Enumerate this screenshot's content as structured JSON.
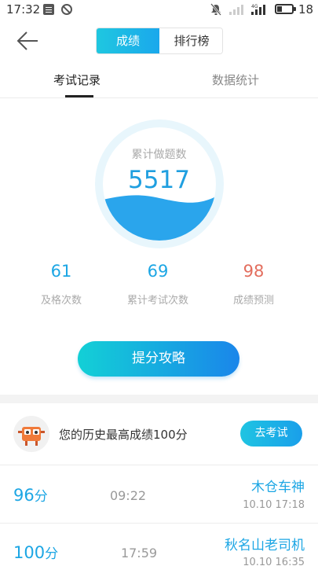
{
  "status_bar": {
    "time": "17:32",
    "battery_level": "18",
    "icons": [
      "news-icon",
      "block-icon",
      "mute-icon",
      "signal-icon",
      "signal-4g-icon",
      "battery-icon"
    ]
  },
  "header": {
    "back_icon": "arrow-left-icon",
    "segments": [
      {
        "label": "成绩",
        "active": true
      },
      {
        "label": "排行榜",
        "active": false
      }
    ]
  },
  "tabs": [
    {
      "label": "考试记录",
      "active": true
    },
    {
      "label": "数据统计",
      "active": false
    }
  ],
  "gauge": {
    "label": "累计做题数",
    "value": "5517"
  },
  "stats": [
    {
      "value": "61",
      "label": "及格次数"
    },
    {
      "value": "69",
      "label": "累计考试次数"
    },
    {
      "value": "98",
      "label": "成绩预测"
    }
  ],
  "tips_button": "提分攻略",
  "best": {
    "text": "您的历史最高成绩100分",
    "button": "去考试"
  },
  "records": [
    {
      "score": "96",
      "unit": "分",
      "duration": "09:22",
      "title": "木仓车神",
      "date": "10.10  17:18"
    },
    {
      "score": "100",
      "unit": "分",
      "duration": "17:59",
      "title": "秋名山老司机",
      "date": "10.10  16:35"
    }
  ],
  "colors": {
    "accent": "#1ca6e4",
    "prediction": "#e36e5e",
    "wave": "#2aa5ec"
  }
}
